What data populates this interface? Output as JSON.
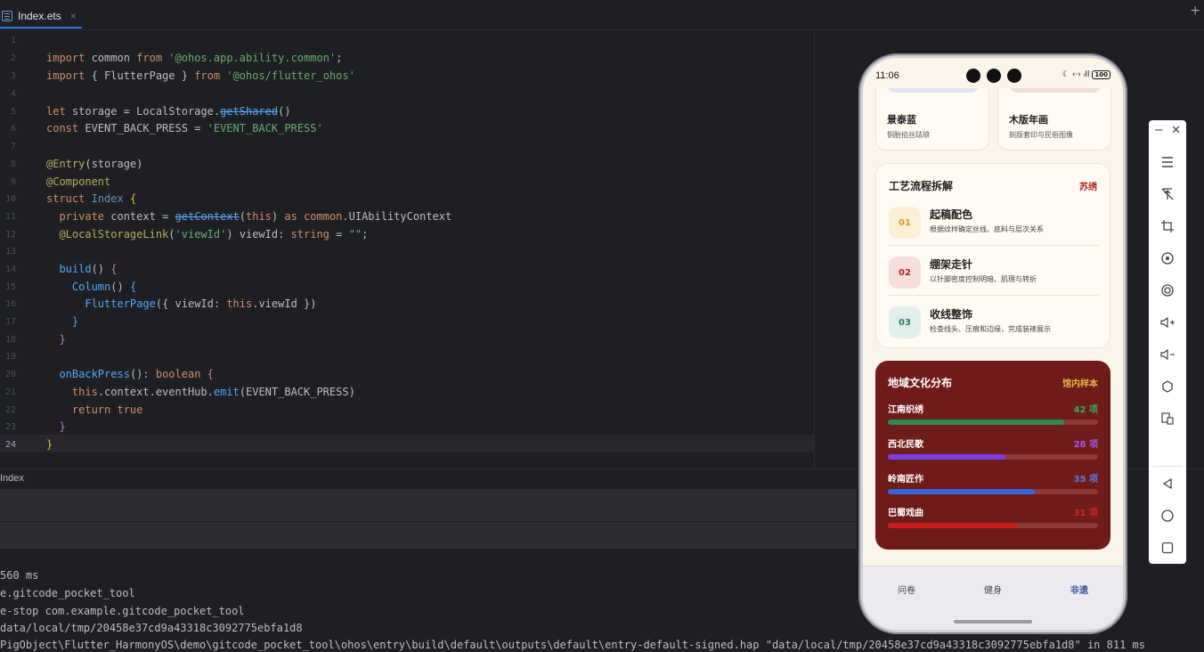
{
  "tab": {
    "filename": "Index.ets",
    "close": "×"
  },
  "corner_plus": "+",
  "code": {
    "line_numbers": [
      "1",
      "2",
      "3",
      "4",
      "5",
      "6",
      "7",
      "8",
      "9",
      "10",
      "11",
      "12",
      "13",
      "14",
      "15",
      "16",
      "17",
      "18",
      "19",
      "20",
      "21",
      "22",
      "23",
      "24"
    ],
    "active_line": "24"
  },
  "panel": {
    "title": "Index",
    "logs": [
      "560 ms",
      "e.gitcode_pocket_tool",
      "e-stop com.example.gitcode_pocket_tool",
      "data/local/tmp/20458e37cd9a43318c3092775ebfa1d8",
      "PigObject\\Flutter_HarmonyOS\\demo\\gitcode_pocket_tool\\ohos\\entry\\build\\default\\outputs\\default\\entry-default-signed.hap \"data/local/tmp/20458e37cd9a43318c3092775ebfa1d8\" in 811 ms"
    ]
  },
  "phone": {
    "status": {
      "time": "11:06",
      "icons": "☾ ‹·› ᵢll",
      "battery": "100"
    },
    "top_cards": [
      {
        "title": "景泰蓝",
        "subtitle": "铜胎掐丝珐琅",
        "blob_color": "#dfe3f3"
      },
      {
        "title": "木版年画",
        "subtitle": "刻版套印与民俗图像",
        "blob_color": "#f3dcd6"
      }
    ],
    "craft": {
      "title": "工艺流程拆解",
      "tag": "苏绣",
      "steps": [
        {
          "num": "01",
          "title": "起稿配色",
          "subtitle": "根据纹样确定丝线、底料与层次关系",
          "bg": "#fbefd6",
          "fg": "#d49a2a"
        },
        {
          "num": "02",
          "title": "绷架走针",
          "subtitle": "以针脚密度控制明暗、肌理与转折",
          "bg": "#f7e0dc",
          "fg": "#b4241f"
        },
        {
          "num": "03",
          "title": "收线整饰",
          "subtitle": "检查线头、压痕和边缘，完成装裱展示",
          "bg": "#e1eeea",
          "fg": "#2f7a66"
        }
      ]
    },
    "region": {
      "title": "地域文化分布",
      "tag": "馆内样本",
      "rows": [
        {
          "name": "江南织绣",
          "count": "42 项",
          "value": 42,
          "color": "#2e8b57",
          "count_color": "#3aa86b"
        },
        {
          "name": "西北民歌",
          "count": "28 项",
          "value": 28,
          "color": "#7b3fe4",
          "count_color": "#9b5cf0"
        },
        {
          "name": "岭南匠作",
          "count": "35 项",
          "value": 35,
          "color": "#3566e0",
          "count_color": "#4f7ff0"
        },
        {
          "name": "巴蜀戏曲",
          "count": "31 项",
          "value": 31,
          "color": "#c81d1d",
          "count_color": "#d8262a"
        }
      ],
      "max": 50
    },
    "nav": {
      "items": [
        "问卷",
        "健身",
        "非遗"
      ],
      "active": "非遗"
    }
  },
  "emulator_toolbar": {
    "minimize": "−",
    "close": "✕",
    "icons": [
      "menu-icon",
      "pin-off-icon",
      "crop-icon",
      "rotate-icon",
      "screenshot-icon",
      "volume-up-icon",
      "volume-down-icon",
      "shake-icon",
      "multi-device-icon"
    ],
    "nav_icons": [
      "back-icon",
      "home-icon",
      "recent-apps-icon"
    ]
  }
}
